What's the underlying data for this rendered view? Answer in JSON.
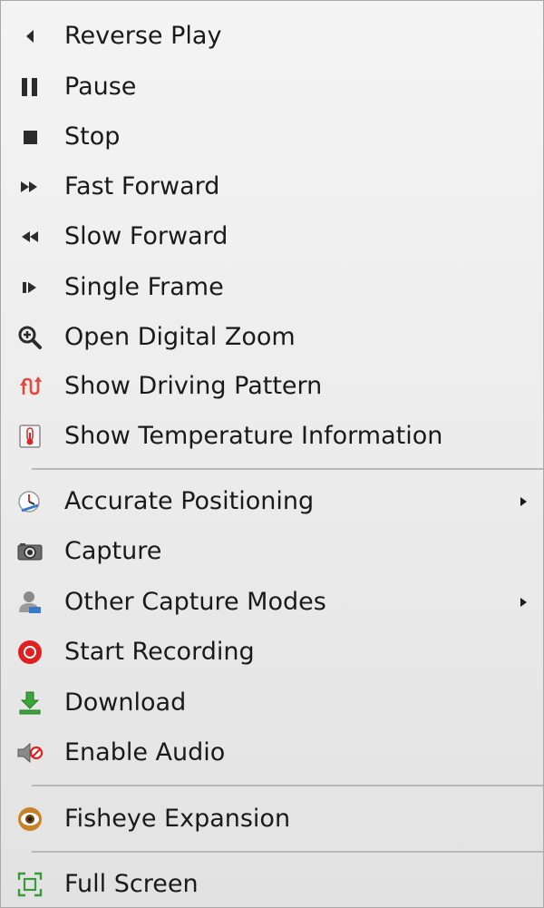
{
  "menu": {
    "items": [
      {
        "label": "Reverse Play"
      },
      {
        "label": "Pause"
      },
      {
        "label": "Stop"
      },
      {
        "label": "Fast Forward"
      },
      {
        "label": "Slow Forward"
      },
      {
        "label": "Single Frame"
      },
      {
        "label": "Open Digital Zoom"
      },
      {
        "label": "Show Driving Pattern"
      },
      {
        "label": "Show Temperature Information"
      },
      {
        "label": "Accurate Positioning",
        "has_submenu": true
      },
      {
        "label": "Capture"
      },
      {
        "label": "Other Capture Modes",
        "has_submenu": true
      },
      {
        "label": "Start Recording"
      },
      {
        "label": "Download"
      },
      {
        "label": "Enable Audio"
      },
      {
        "label": "Fisheye Expansion"
      },
      {
        "label": "Full Screen"
      }
    ],
    "icons": [
      "reverse-play-icon",
      "pause-icon",
      "stop-icon",
      "fast-forward-icon",
      "slow-forward-icon",
      "single-frame-icon",
      "zoom-in-icon",
      "driving-pattern-icon",
      "thermometer-icon",
      "clock-positioning-icon",
      "camera-icon",
      "user-capture-icon",
      "record-icon",
      "download-icon",
      "speaker-muted-icon",
      "fisheye-icon",
      "full-screen-icon"
    ]
  },
  "colors": {
    "text": "#1a1a1a",
    "icon_dark": "#2b2b2b",
    "driving_pattern_red": "#e8473c",
    "record_red": "#e02020",
    "download_green": "#3aa53a",
    "fullscreen_green": "#3a9a3a"
  }
}
